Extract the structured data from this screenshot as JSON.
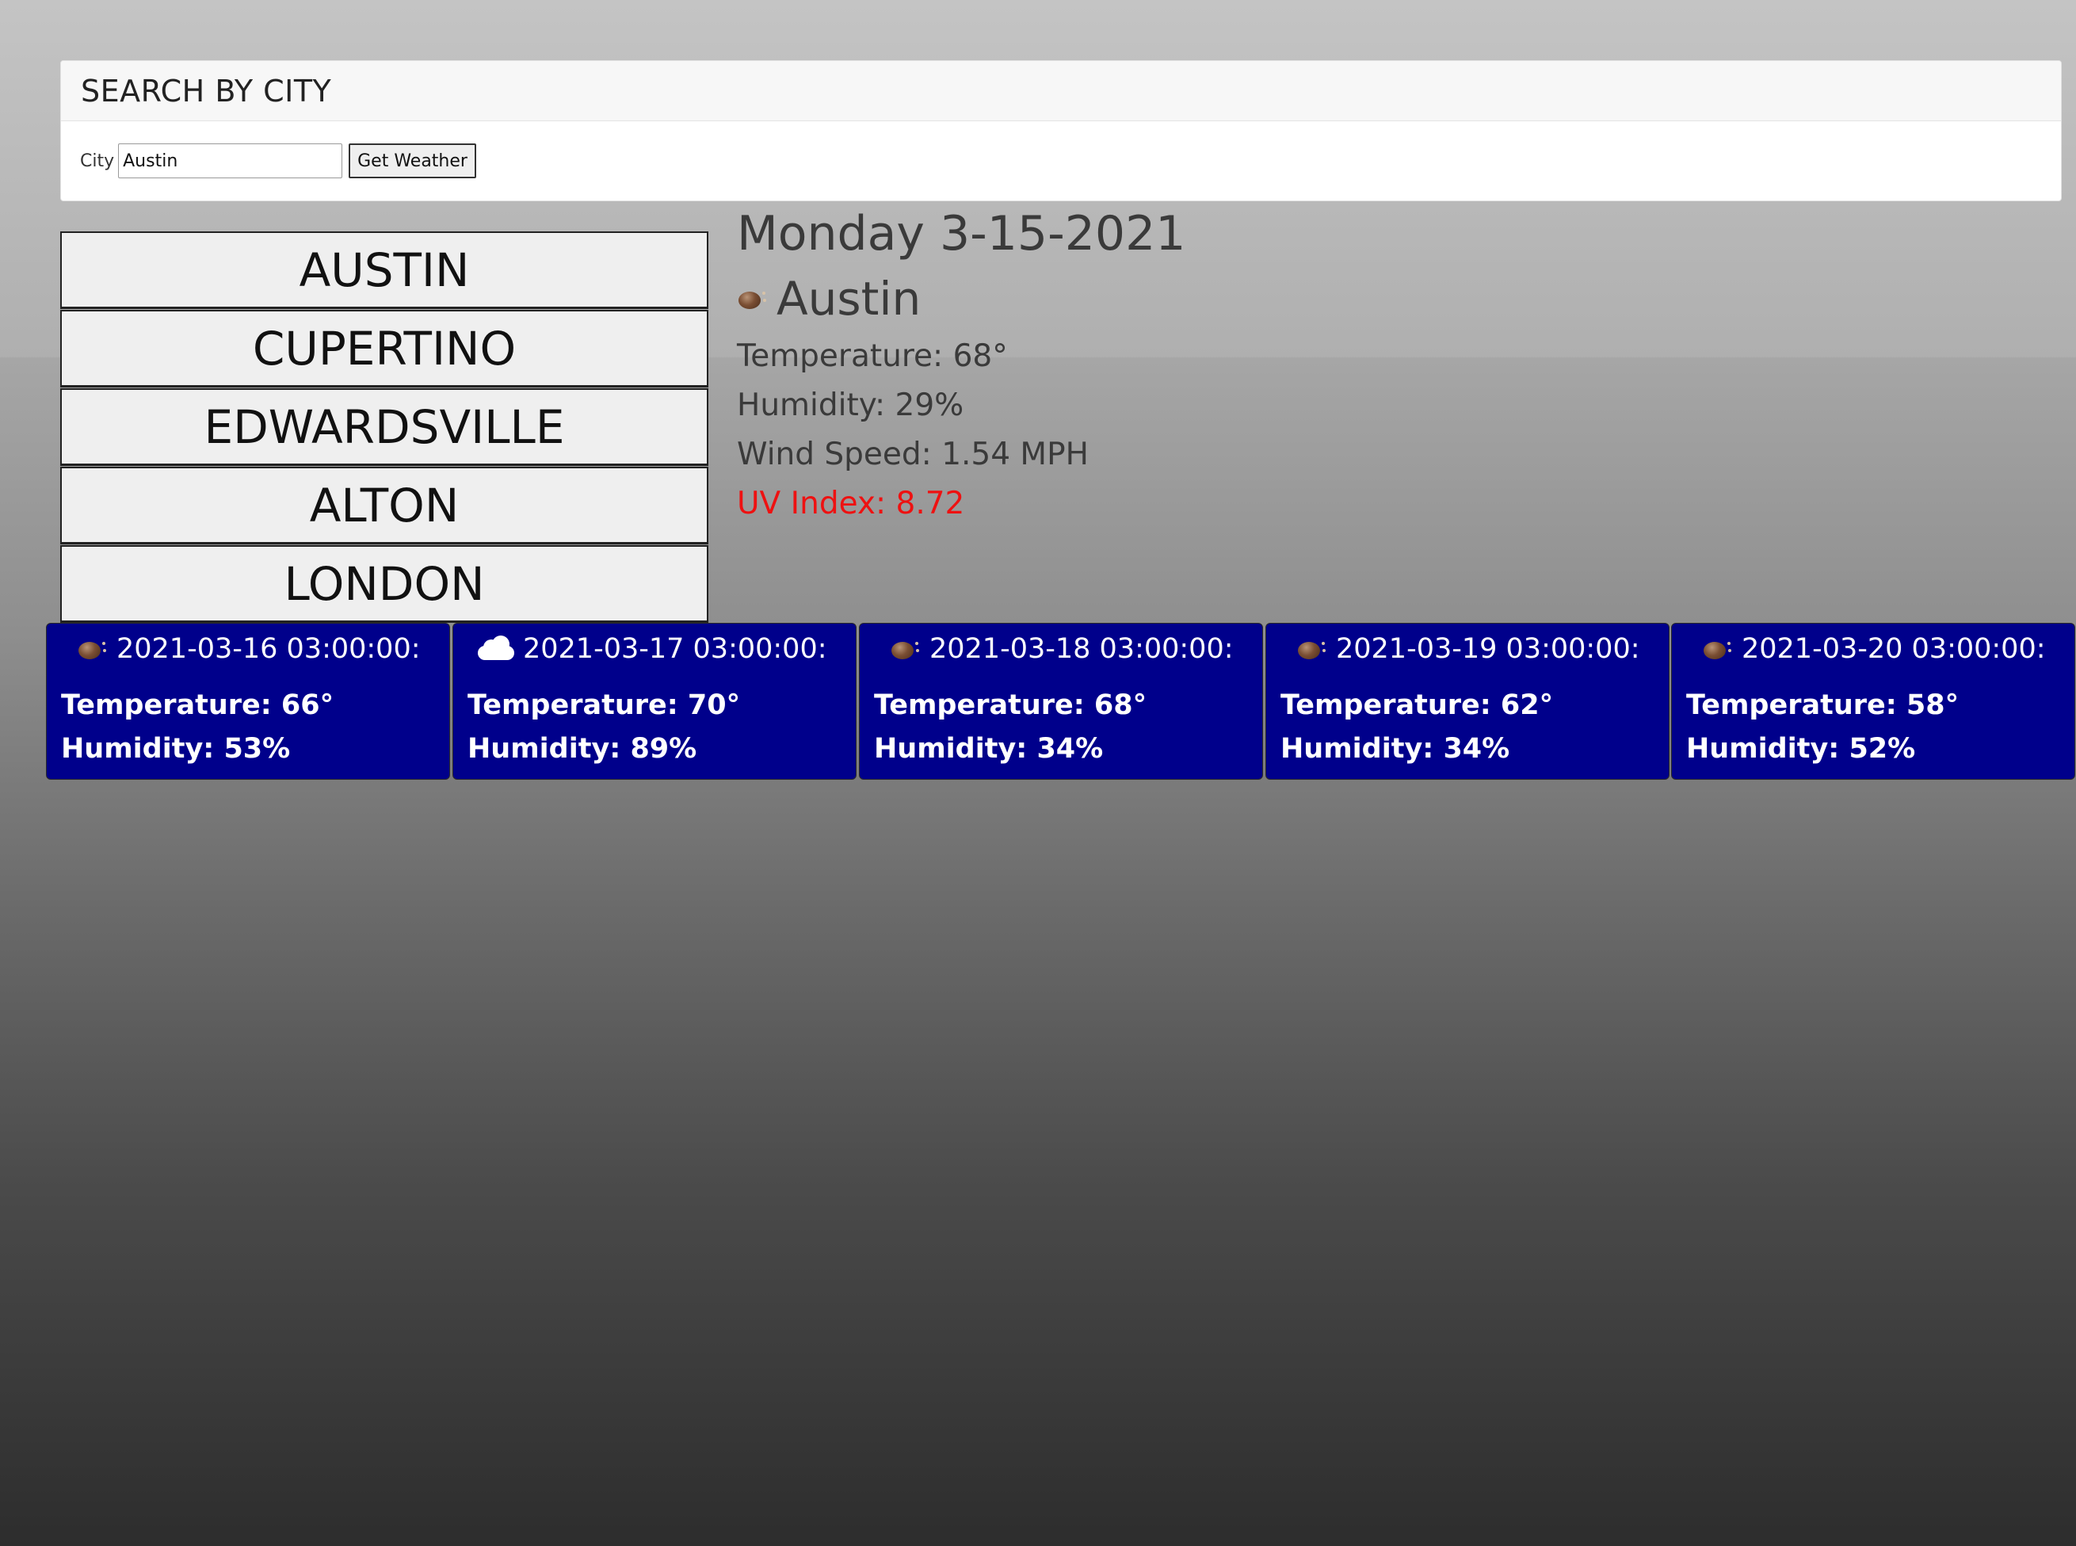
{
  "search": {
    "title": "SEARCH BY CITY",
    "label": "City",
    "value": "Austin",
    "button": "Get Weather"
  },
  "history": [
    {
      "label": "AUSTIN"
    },
    {
      "label": "CUPERTINO"
    },
    {
      "label": "EDWARDSVILLE"
    },
    {
      "label": "ALTON"
    },
    {
      "label": "LONDON"
    }
  ],
  "current": {
    "date": "Monday 3-15-2021",
    "icon": "weather-icon",
    "city": "Austin",
    "temperature": "Temperature: 68°",
    "humidity": "Humidity: 29%",
    "wind": "Wind Speed: 1.54 MPH",
    "uv": "UV Index: 8.72",
    "uv_color": "#ee1111"
  },
  "forecast": [
    {
      "date": "2021-03-16 03:00:00:",
      "icon": "weather-icon",
      "temperature": "Temperature: 66°",
      "humidity": "Humidity: 53%"
    },
    {
      "date": "2021-03-17 03:00:00:",
      "icon": "cloud-icon",
      "temperature": "Temperature: 70°",
      "humidity": "Humidity: 89%"
    },
    {
      "date": "2021-03-18 03:00:00:",
      "icon": "weather-icon",
      "temperature": "Temperature: 68°",
      "humidity": "Humidity: 34%"
    },
    {
      "date": "2021-03-19 03:00:00:",
      "icon": "weather-icon",
      "temperature": "Temperature: 62°",
      "humidity": "Humidity: 34%"
    },
    {
      "date": "2021-03-20 03:00:00:",
      "icon": "weather-icon",
      "temperature": "Temperature: 58°",
      "humidity": "Humidity: 52%"
    }
  ],
  "colors": {
    "forecast_bg": "#00008b",
    "uv_high": "#ee1111"
  }
}
